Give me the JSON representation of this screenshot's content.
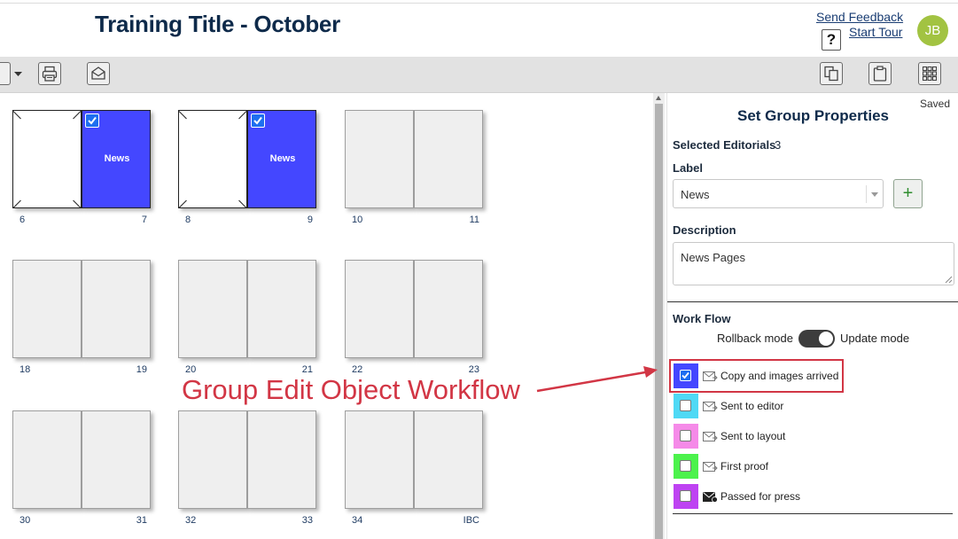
{
  "header": {
    "title": "Training Title - October",
    "send_feedback": "Send Feedback",
    "start_tour": "Start Tour",
    "help": "?",
    "avatar_initials": "JB"
  },
  "toolbar": {
    "icons": [
      "view-dropdown-icon",
      "print-icon",
      "mail-icon",
      "copy-pages-icon",
      "clipboard-icon",
      "grid-view-icon"
    ]
  },
  "spreads": [
    {
      "left": "6",
      "right": "7",
      "left_style": "blank",
      "right_style": "news",
      "right_label": "News",
      "checked": true
    },
    {
      "left": "8",
      "right": "9",
      "left_style": "blank",
      "right_style": "news",
      "right_label": "News",
      "checked": true
    },
    {
      "left": "10",
      "right": "11",
      "left_style": "grey",
      "right_style": "grey",
      "right_label": "",
      "checked": false
    },
    {
      "left": "18",
      "right": "19",
      "left_style": "grey",
      "right_style": "grey",
      "right_label": "",
      "checked": false
    },
    {
      "left": "20",
      "right": "21",
      "left_style": "grey",
      "right_style": "grey",
      "right_label": "",
      "checked": false
    },
    {
      "left": "22",
      "right": "23",
      "left_style": "grey",
      "right_style": "grey",
      "right_label": "",
      "checked": false
    },
    {
      "left": "30",
      "right": "31",
      "left_style": "grey",
      "right_style": "grey",
      "right_label": "",
      "checked": false
    },
    {
      "left": "32",
      "right": "33",
      "left_style": "grey",
      "right_style": "grey",
      "right_label": "",
      "checked": false
    },
    {
      "left": "34",
      "right": "IBC",
      "left_style": "grey",
      "right_style": "grey",
      "right_label": "",
      "checked": false
    }
  ],
  "annotation": "Group Edit Object Workflow",
  "panel": {
    "saved": "Saved",
    "title": "Set Group Properties",
    "selected_label": "Selected Editorials",
    "selected_count": "3",
    "label_heading": "Label",
    "label_value": "News",
    "add_symbol": "+",
    "description_heading": "Description",
    "description_value": "News Pages",
    "workflow_heading": "Work Flow",
    "rollback_mode": "Rollback mode",
    "update_mode": "Update mode",
    "update_mode_on": true,
    "workflow": [
      {
        "label": "Copy and images arrived",
        "color": "#4447ff",
        "checked": true,
        "icon": "envelope-outline-icon"
      },
      {
        "label": "Sent to editor",
        "color": "#4fd9f5",
        "checked": false,
        "icon": "envelope-outline-icon"
      },
      {
        "label": "Sent to layout",
        "color": "#f58ae8",
        "checked": false,
        "icon": "envelope-outline-icon"
      },
      {
        "label": "First proof",
        "color": "#4cf24c",
        "checked": false,
        "icon": "envelope-outline-icon"
      },
      {
        "label": "Passed for press",
        "color": "#be43f2",
        "checked": false,
        "icon": "envelope-filled-icon"
      }
    ]
  },
  "colors": {
    "title": "#0e2a4a",
    "annotation": "#d23645",
    "avatar": "#a2c342",
    "news_page": "#4447ff",
    "check": "#1e6ff0"
  }
}
